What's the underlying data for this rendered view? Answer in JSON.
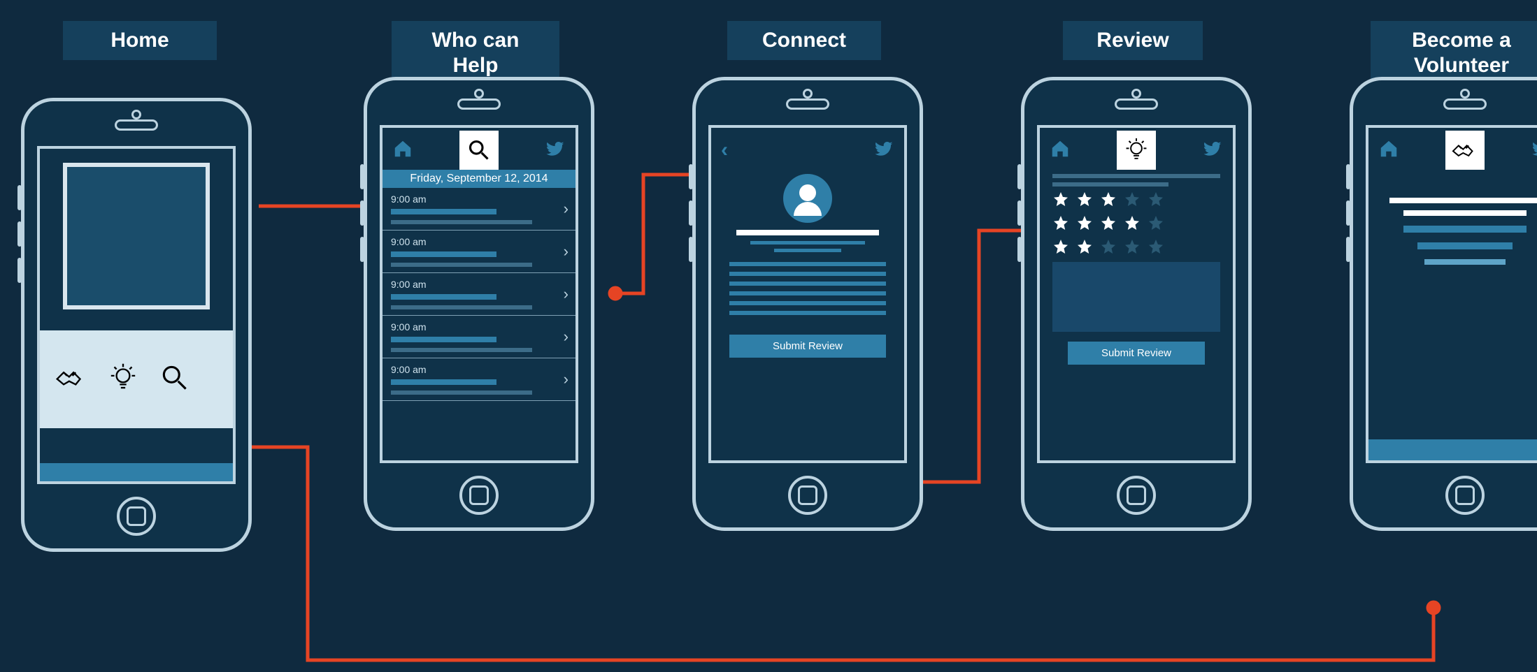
{
  "labels": {
    "home": "Home",
    "who": "Who can\nHelp",
    "connect": "Connect",
    "review": "Review",
    "volunteer": "Become a\nVolunteer"
  },
  "who_screen": {
    "date_header": "Friday, September 12, 2014",
    "slots": [
      "9:00 am",
      "9:00 am",
      "9:00 am",
      "9:00 am",
      "9:00 am"
    ]
  },
  "connect_screen": {
    "button": "Submit Review"
  },
  "review_screen": {
    "ratings": [
      3,
      4,
      2
    ],
    "max_stars": 5,
    "button": "Submit Review"
  },
  "icons": {
    "handshake": "handshake-icon",
    "idea": "lightbulb-icon",
    "search": "search-icon",
    "home": "home-icon",
    "twitter": "twitter-icon",
    "back": "chevron-left-icon",
    "right": "chevron-right-icon"
  }
}
